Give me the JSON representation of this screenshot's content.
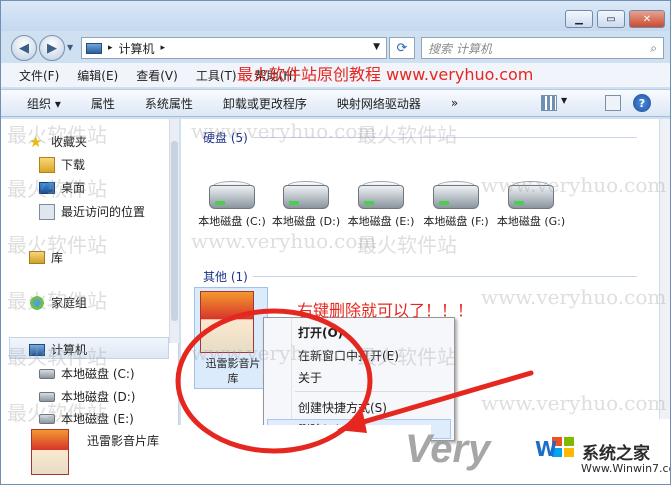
{
  "colors": {
    "annotation_red": "#e5271f",
    "group_header": "#1e3287",
    "selection": "#dcebfc"
  },
  "banner": "最火软件站原创教程 www.veryhuo.com",
  "annotation": "右键删除就可以了！！！",
  "watermark": {
    "site": "最火软件站",
    "url": "www.veryhuo.com"
  },
  "address": {
    "path": "计算机",
    "separator": "▸",
    "search_placeholder": "搜索 计算机"
  },
  "menubar": [
    "文件(F)",
    "编辑(E)",
    "查看(V)",
    "工具(T)",
    "帮助(H)"
  ],
  "toolbar": [
    "组织 ▾",
    "属性",
    "系统属性",
    "卸载或更改程序",
    "映射网络驱动器",
    "»"
  ],
  "sidebar": {
    "favorites": "收藏夹",
    "favorite_items": [
      "下载",
      "桌面",
      "最近访问的位置"
    ],
    "library": "库",
    "homegroup": "家庭组",
    "computer": "计算机",
    "drives": [
      "本地磁盘 (C:)",
      "本地磁盘 (D:)",
      "本地磁盘 (E:)"
    ]
  },
  "content": {
    "hard_disks_header": "硬盘 (5)",
    "drives": [
      "本地磁盘 (C:)",
      "本地磁盘 (D:)",
      "本地磁盘 (E:)",
      "本地磁盘 (F:)",
      "本地磁盘 (G:)"
    ],
    "other_header": "其他 (1)",
    "other_item_line1": "迅雷影音片",
    "other_item_line2": "库"
  },
  "context_menu": [
    "打开(O)",
    "在新窗口中打开(E)",
    "关于",
    "创建快捷方式(S)",
    "删除(D)"
  ],
  "bottom_item": "迅雷影音片库",
  "logo": {
    "brand": "Very",
    "site_name": "系统之家",
    "url": "Www.Winwin7.com",
    "w_letter": "W"
  },
  "icons": {
    "back": "arrow-left-icon",
    "forward": "arrow-right-icon",
    "refresh": "refresh-icon",
    "search": "search-icon",
    "help": "help-icon"
  }
}
